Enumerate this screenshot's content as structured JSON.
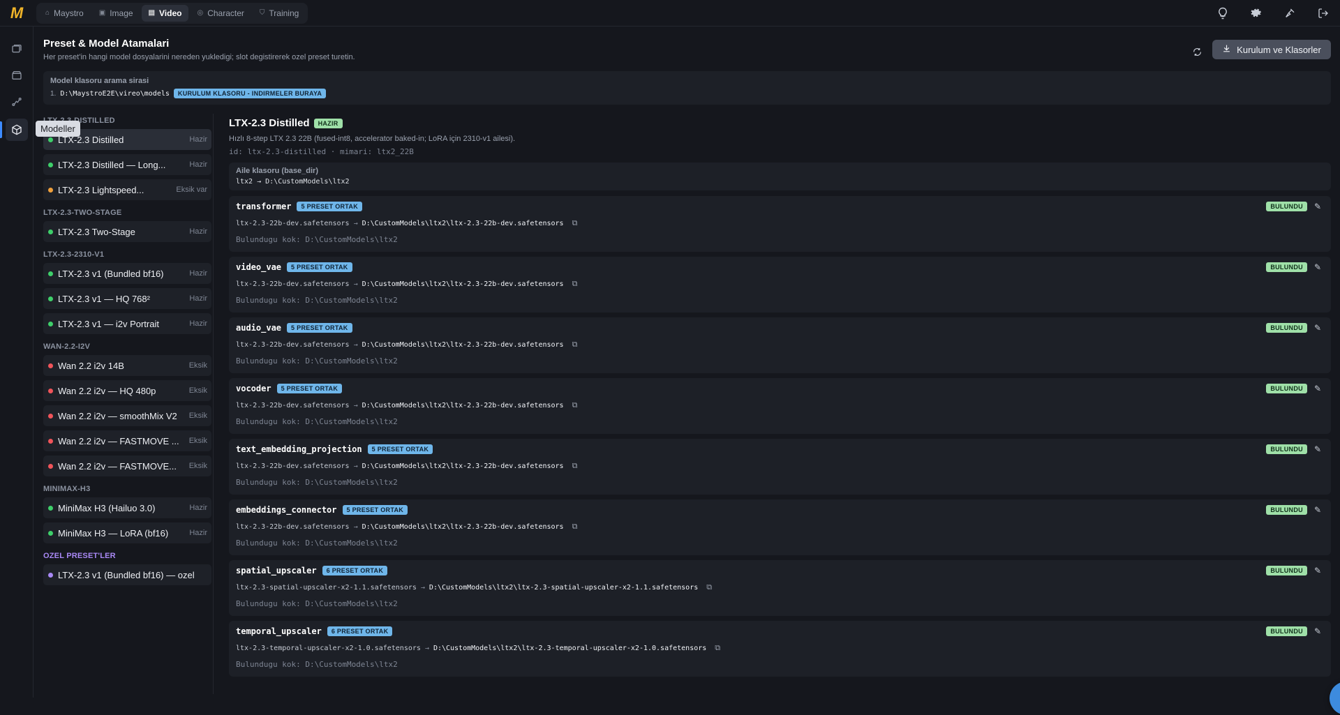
{
  "app": {
    "logo": "M"
  },
  "top_tabs": [
    {
      "label": "Maystro",
      "icon": "home-icon"
    },
    {
      "label": "Image",
      "icon": "image-icon"
    },
    {
      "label": "Video",
      "icon": "video-icon",
      "active": true
    },
    {
      "label": "Character",
      "icon": "character-icon"
    },
    {
      "label": "Training",
      "icon": "training-icon"
    }
  ],
  "top_right_icons": [
    "lightbulb-icon",
    "gear-icon",
    "broom-icon",
    "logout-icon"
  ],
  "rail": {
    "tooltip": "Modeller"
  },
  "page": {
    "title": "Preset & Model Atamalari",
    "subtitle": "Her preset'in hangi model dosyalarini nereden yukledigi; slot degistirerek ozel preset turetin.",
    "setup_button": "Kurulum ve Klasorler"
  },
  "search_order": {
    "title": "Model klasoru arama sirasi",
    "index": "1.",
    "path": "D:\\MaystroE2E\\vireo\\models",
    "badge": "KURULUM KLASORU - INDIRMELER BURAYA"
  },
  "groups": [
    {
      "name": "LTX-2.3-DISTILLED",
      "items": [
        {
          "name": "LTX-2.3 Distilled",
          "status": "Hazir",
          "color": "#3ecf6a",
          "active": true
        },
        {
          "name": "LTX-2.3 Distilled — Long...",
          "status": "Hazir",
          "color": "#3ecf6a"
        },
        {
          "name": "LTX-2.3 Lightspeed...",
          "status": "Eksik var",
          "color": "#f0a03c"
        }
      ]
    },
    {
      "name": "LTX-2.3-TWO-STAGE",
      "items": [
        {
          "name": "LTX-2.3 Two-Stage",
          "status": "Hazir",
          "color": "#3ecf6a"
        }
      ]
    },
    {
      "name": "LTX-2.3-2310-V1",
      "items": [
        {
          "name": "LTX-2.3 v1 (Bundled bf16)",
          "status": "Hazir",
          "color": "#3ecf6a"
        },
        {
          "name": "LTX-2.3 v1 — HQ 768²",
          "status": "Hazir",
          "color": "#3ecf6a"
        },
        {
          "name": "LTX-2.3 v1 — i2v Portrait",
          "status": "Hazir",
          "color": "#3ecf6a"
        }
      ]
    },
    {
      "name": "WAN-2.2-I2V",
      "items": [
        {
          "name": "Wan 2.2 i2v 14B",
          "status": "Eksik",
          "color": "#f0545a"
        },
        {
          "name": "Wan 2.2 i2v — HQ 480p",
          "status": "Eksik",
          "color": "#f0545a"
        },
        {
          "name": "Wan 2.2 i2v — smoothMix V2",
          "status": "Eksik",
          "color": "#f0545a"
        },
        {
          "name": "Wan 2.2 i2v — FASTMOVE ...",
          "status": "Eksik",
          "color": "#f0545a"
        },
        {
          "name": "Wan 2.2 i2v — FASTMOVE...",
          "status": "Eksik",
          "color": "#f0545a"
        }
      ]
    },
    {
      "name": "MINIMAX-H3",
      "items": [
        {
          "name": "MiniMax H3 (Hailuo 3.0)",
          "status": "Hazir",
          "color": "#3ecf6a"
        },
        {
          "name": "MiniMax H3 — LoRA (bf16)",
          "status": "Hazir",
          "color": "#3ecf6a"
        }
      ]
    },
    {
      "name": "OZEL PRESET'LER",
      "purple": true,
      "items": [
        {
          "name": "LTX-2.3 v1 (Bundled bf16) — ozel",
          "status": "",
          "color": "#a989f5"
        }
      ]
    }
  ],
  "detail": {
    "title": "LTX-2.3 Distilled",
    "badge": "HAZIR",
    "description": "Hızlı 8-step LTX 2.3 22B (fused-int8, accelerator baked-in; LoRA için 2310-v1 ailesi).",
    "id_line": "id: ltx-2.3-distilled · mimari: ltx2_22B",
    "family": {
      "title": "Aile klasoru (base_dir)",
      "row": "ltx2 → D:\\CustomModels\\ltx2"
    },
    "slots": [
      {
        "name": "transformer",
        "shared": "5 PRESET ORTAK",
        "src": "ltx-2.3-22b-dev.safetensors",
        "dst": "D:\\CustomModels\\ltx2\\ltx-2.3-22b-dev.safetensors",
        "root": "Bulundugu kok: D:\\CustomModels\\ltx2",
        "status": "BULUNDU"
      },
      {
        "name": "video_vae",
        "shared": "5 PRESET ORTAK",
        "src": "ltx-2.3-22b-dev.safetensors",
        "dst": "D:\\CustomModels\\ltx2\\ltx-2.3-22b-dev.safetensors",
        "root": "Bulundugu kok: D:\\CustomModels\\ltx2",
        "status": "BULUNDU"
      },
      {
        "name": "audio_vae",
        "shared": "5 PRESET ORTAK",
        "src": "ltx-2.3-22b-dev.safetensors",
        "dst": "D:\\CustomModels\\ltx2\\ltx-2.3-22b-dev.safetensors",
        "root": "Bulundugu kok: D:\\CustomModels\\ltx2",
        "status": "BULUNDU"
      },
      {
        "name": "vocoder",
        "shared": "5 PRESET ORTAK",
        "src": "ltx-2.3-22b-dev.safetensors",
        "dst": "D:\\CustomModels\\ltx2\\ltx-2.3-22b-dev.safetensors",
        "root": "Bulundugu kok: D:\\CustomModels\\ltx2",
        "status": "BULUNDU"
      },
      {
        "name": "text_embedding_projection",
        "shared": "5 PRESET ORTAK",
        "src": "ltx-2.3-22b-dev.safetensors",
        "dst": "D:\\CustomModels\\ltx2\\ltx-2.3-22b-dev.safetensors",
        "root": "Bulundugu kok: D:\\CustomModels\\ltx2",
        "status": "BULUNDU"
      },
      {
        "name": "embeddings_connector",
        "shared": "5 PRESET ORTAK",
        "src": "ltx-2.3-22b-dev.safetensors",
        "dst": "D:\\CustomModels\\ltx2\\ltx-2.3-22b-dev.safetensors",
        "root": "Bulundugu kok: D:\\CustomModels\\ltx2",
        "status": "BULUNDU"
      },
      {
        "name": "spatial_upscaler",
        "shared": "6 PRESET ORTAK",
        "src": "ltx-2.3-spatial-upscaler-x2-1.1.safetensors",
        "dst": "D:\\CustomModels\\ltx2\\ltx-2.3-spatial-upscaler-x2-1.1.safetensors",
        "root": "Bulundugu kok: D:\\CustomModels\\ltx2",
        "status": "BULUNDU"
      },
      {
        "name": "temporal_upscaler",
        "shared": "6 PRESET ORTAK",
        "src": "ltx-2.3-temporal-upscaler-x2-1.0.safetensors",
        "dst": "D:\\CustomModels\\ltx2\\ltx-2.3-temporal-upscaler-x2-1.0.safetensors",
        "root": "Bulundugu kok: D:\\CustomModels\\ltx2",
        "status": "BULUNDU"
      }
    ]
  }
}
